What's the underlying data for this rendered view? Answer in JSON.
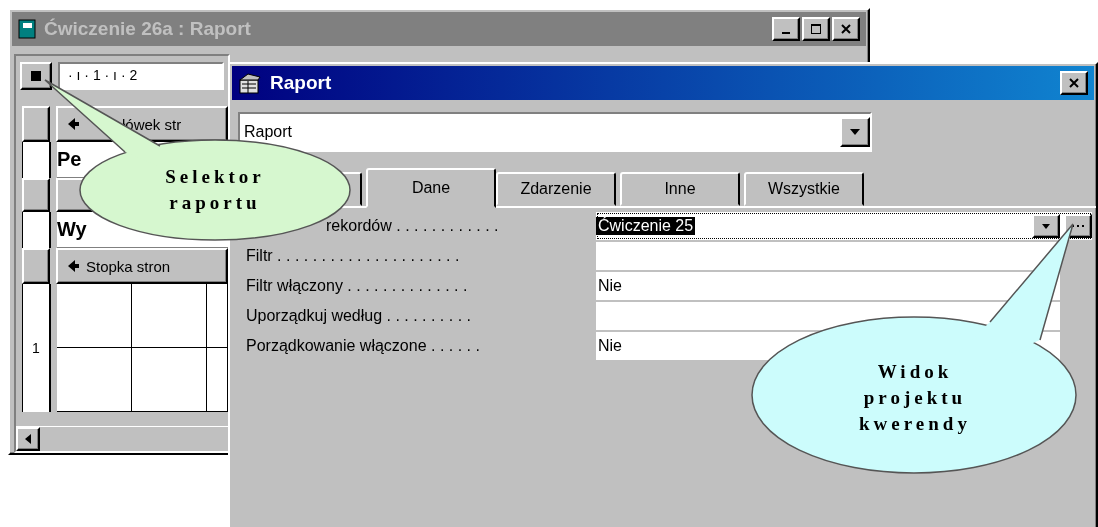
{
  "background_window": {
    "title": "Ćwiczenie 26a : Raport",
    "ruler": "· ı · 1 · ı · 2",
    "sections": [
      {
        "kind": "header",
        "label": "łówek str"
      },
      {
        "kind": "text",
        "label": "Pe"
      },
      {
        "kind": "band"
      },
      {
        "kind": "text",
        "label": "Wy"
      },
      {
        "kind": "header",
        "label": "Stopka stron"
      },
      {
        "kind": "grid"
      }
    ],
    "vertical_ruler": [
      "1"
    ]
  },
  "dialog": {
    "title": "Raport",
    "object_select": {
      "value": "Raport"
    },
    "tabs": [
      {
        "selected": false
      },
      {
        "label": "Dane",
        "selected": true
      },
      {
        "label": "Zdarzenie",
        "selected": false
      },
      {
        "label": "Inne",
        "selected": false
      },
      {
        "label": "Wszystkie",
        "selected": false
      }
    ],
    "properties": [
      {
        "kind": "builder",
        "label": "rekordów . . . . . . . . . . . .",
        "value": "Ćwiczenie 25",
        "selected": true
      },
      {
        "kind": "plain",
        "label": "Filtr . . . . . . . . . . . . . . . . . . . . .",
        "selected": false
      },
      {
        "kind": "plain",
        "label": "Filtr włączony . . . . . . . . . . . . . .",
        "value": "Nie",
        "selected": false
      },
      {
        "kind": "plain",
        "label": "Uporządkuj według . . . . . . . . . .",
        "selected": false
      },
      {
        "kind": "plain",
        "label": "Porządkowanie włączone . . . . . .",
        "value": "Nie",
        "selected": false
      }
    ]
  },
  "callouts": [
    {
      "lines": [
        "Selektor",
        "raportu"
      ],
      "color": "#d6f7cf"
    },
    {
      "lines": [
        "Widok",
        "projektu",
        "kwerendy"
      ],
      "color": "#ccfcfc"
    }
  ]
}
